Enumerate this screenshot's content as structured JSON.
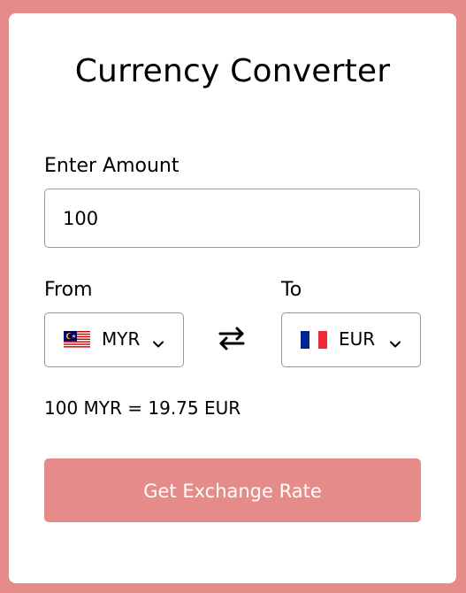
{
  "app": {
    "title": "Currency Converter"
  },
  "amount": {
    "label": "Enter Amount",
    "value": "100"
  },
  "from": {
    "label": "From",
    "currency_code": "MYR",
    "flag_icon": "malaysia-flag"
  },
  "to": {
    "label": "To",
    "currency_code": "EUR",
    "flag_icon": "france-flag"
  },
  "swap": {
    "icon": "swap-arrows-icon"
  },
  "result": {
    "text": "100 MYR = 19.75 EUR"
  },
  "action": {
    "button_label": "Get Exchange Rate"
  },
  "colors": {
    "accent": "#e58c8a",
    "card": "#ffffff",
    "border": "#999999"
  }
}
